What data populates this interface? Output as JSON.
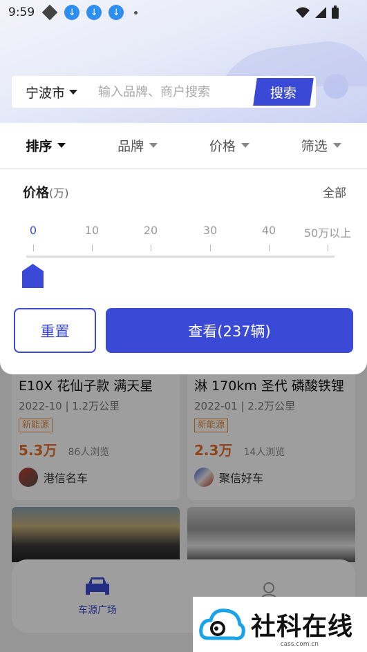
{
  "status_bar": {
    "time": "9:59",
    "download_icons": [
      "download-icon",
      "download-icon",
      "download-icon"
    ]
  },
  "search": {
    "city": "宁波市",
    "placeholder": "输入品牌、商户搜索",
    "button": "搜索"
  },
  "filter_tabs": [
    {
      "label": "排序",
      "active": true
    },
    {
      "label": "品牌",
      "active": false
    },
    {
      "label": "价格",
      "active": false
    },
    {
      "label": "筛选",
      "active": false
    }
  ],
  "price_filter": {
    "title": "价格",
    "unit": "(万)",
    "all_label": "全部",
    "ticks": [
      "0",
      "10",
      "20",
      "30",
      "40",
      "50万以上"
    ],
    "selected_value": 0
  },
  "actions": {
    "reset": "重置",
    "view": "查看(237辆)"
  },
  "cards": [
    {
      "title": "E10X 花仙子款 满天星",
      "meta": "2022-10 | 1.2万公里",
      "tag": "新能源",
      "price": "5.3万",
      "views": "86人浏览",
      "dealer": "港信名车"
    },
    {
      "title": "淋 170km 圣代 磷酸铁锂",
      "meta": "2022-01 | 2.2万公里",
      "tag": "新能源",
      "price": "2.3万",
      "views": "14人浏览",
      "dealer": "聚信好车"
    }
  ],
  "bottom_nav": [
    {
      "label": "车源广场",
      "icon": "car-icon"
    },
    {
      "label": "",
      "icon": "person-icon"
    }
  ],
  "watermark": {
    "text": "社科在线",
    "sub": "cass.com.cn"
  },
  "colors": {
    "accent": "#3a49d6",
    "price": "#e6702e",
    "tag": "#e28a3c"
  }
}
